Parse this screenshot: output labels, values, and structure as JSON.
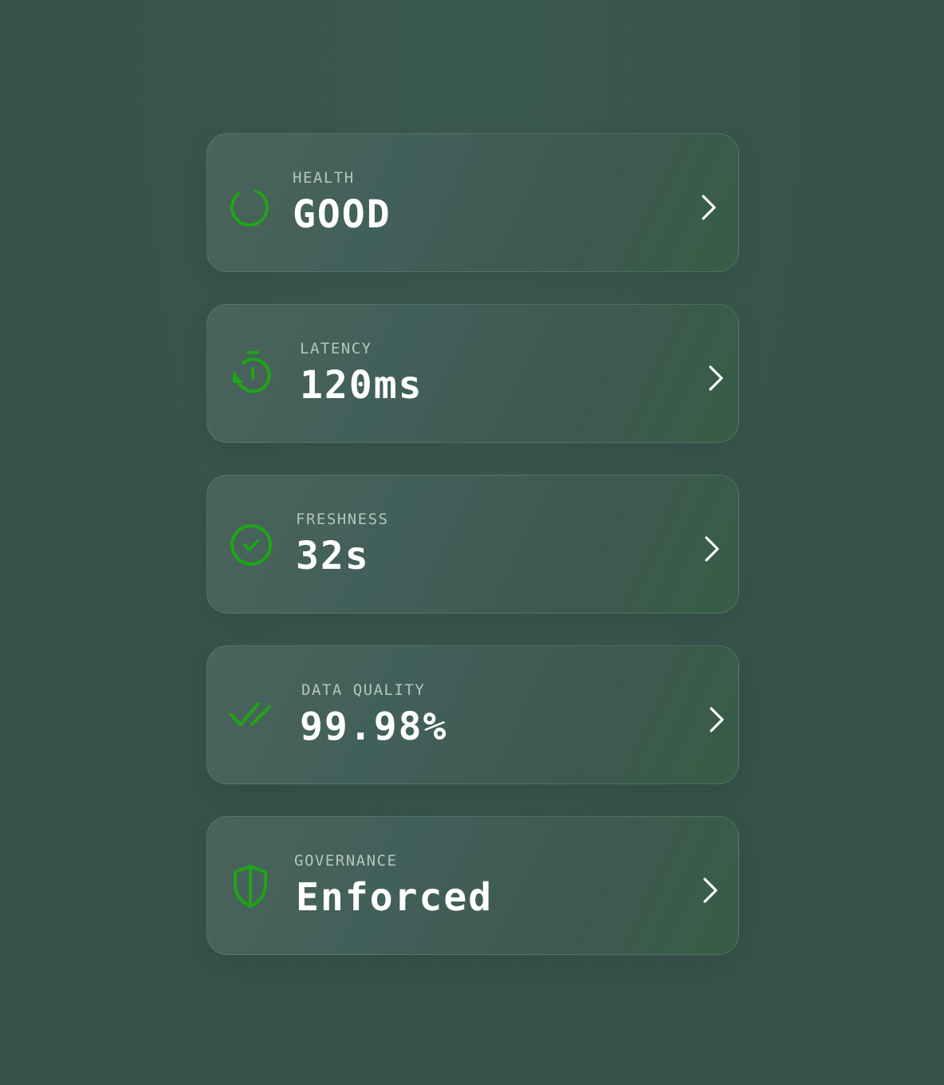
{
  "accent_color": "#1fa516",
  "cards": [
    {
      "label": "HEALTH",
      "value": "GOOD",
      "icon": "loading-ring-icon"
    },
    {
      "label": "LATENCY",
      "value": "120ms",
      "icon": "timer-icon"
    },
    {
      "label": "FRESHNESS",
      "value": "32s",
      "icon": "check-circle-icon"
    },
    {
      "label": "DATA QUALITY",
      "value": "99.98%",
      "icon": "double-check-icon"
    },
    {
      "label": "GOVERNANCE",
      "value": "Enforced",
      "icon": "shield-icon"
    }
  ]
}
